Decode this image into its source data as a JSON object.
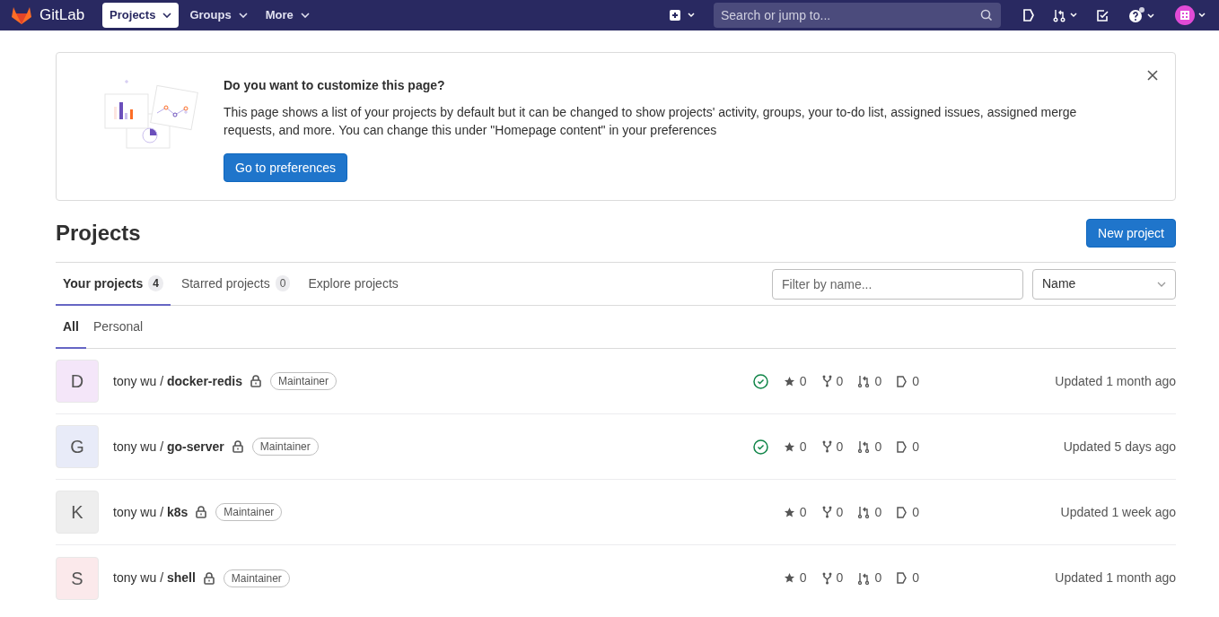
{
  "navbar": {
    "brand": "GitLab",
    "menus": [
      {
        "label": "Projects",
        "selected": true
      },
      {
        "label": "Groups",
        "selected": false
      },
      {
        "label": "More",
        "selected": false
      }
    ],
    "search": {
      "placeholder": "Search or jump to..."
    }
  },
  "banner": {
    "title": "Do you want to customize this page?",
    "text": "This page shows a list of your projects by default but it can be changed to show projects' activity, groups, your to-do list, assigned issues, assigned merge requests, and more. You can change this under \"Homepage content\" in your preferences",
    "button": "Go to preferences"
  },
  "heading": "Projects",
  "new_button": "New project",
  "tabs": [
    {
      "label": "Your projects",
      "count": "4",
      "selected": true
    },
    {
      "label": "Starred projects",
      "count": "0",
      "selected": false
    },
    {
      "label": "Explore projects",
      "selected": false
    }
  ],
  "filter": {
    "placeholder": "Filter by name..."
  },
  "sort": {
    "value": "Name"
  },
  "subtabs": [
    {
      "label": "All",
      "selected": true
    },
    {
      "label": "Personal",
      "selected": false
    }
  ],
  "projects": [
    {
      "letter": "D",
      "color": "#f4e6f9",
      "namespace": "tony wu /",
      "name": "docker-redis",
      "role": "Maintainer",
      "pipeline_passed": true,
      "stars": "0",
      "forks": "0",
      "merge_requests": "0",
      "issues": "0",
      "updated": "Updated 1 month ago"
    },
    {
      "letter": "G",
      "color": "#e8ebf8",
      "namespace": "tony wu /",
      "name": "go-server",
      "role": "Maintainer",
      "pipeline_passed": true,
      "stars": "0",
      "forks": "0",
      "merge_requests": "0",
      "issues": "0",
      "updated": "Updated 5 days ago"
    },
    {
      "letter": "K",
      "color": "#eeeeee",
      "namespace": "tony wu /",
      "name": "k8s",
      "role": "Maintainer",
      "pipeline_passed": false,
      "stars": "0",
      "forks": "0",
      "merge_requests": "0",
      "issues": "0",
      "updated": "Updated 1 week ago"
    },
    {
      "letter": "S",
      "color": "#fbe9eb",
      "namespace": "tony wu /",
      "name": "shell",
      "role": "Maintainer",
      "pipeline_passed": false,
      "stars": "0",
      "forks": "0",
      "merge_requests": "0",
      "issues": "0",
      "updated": "Updated 1 month ago"
    }
  ]
}
